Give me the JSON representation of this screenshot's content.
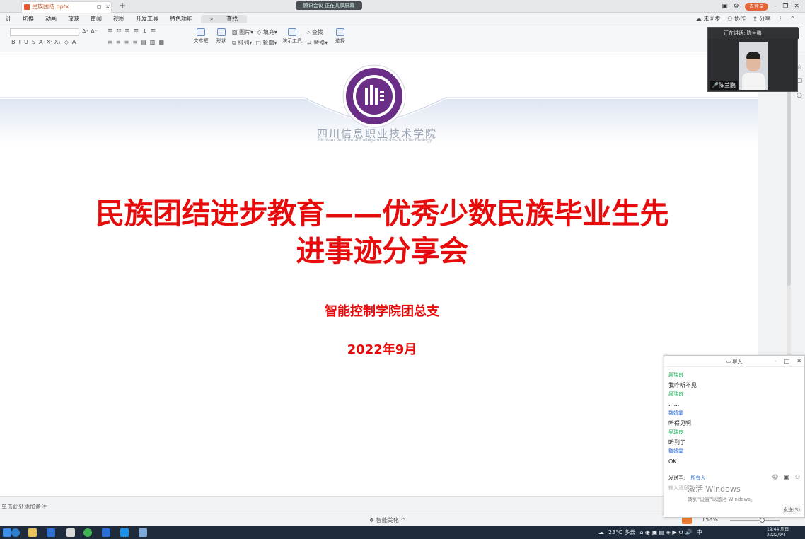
{
  "titlebar": {
    "tab_name": "民族团结.pptx",
    "new_tab": "+",
    "meeting_status": "腾讯会议 正在共享屏幕",
    "login_label": "去登录",
    "unsync": "未同步",
    "collab": "协作",
    "share": "分享"
  },
  "menu": {
    "items": [
      "计",
      "切换",
      "动画",
      "放映",
      "审阅",
      "视图",
      "开发工具",
      "特色功能"
    ],
    "search": "查找"
  },
  "ribbon": {
    "textbox": "文本框",
    "shape": "形状",
    "image": "图片",
    "arrange": "排列",
    "fill": "填充",
    "outline": "轮廓",
    "slide_tools": "演示工具",
    "find": "查找",
    "replace": "替换",
    "select": "选择"
  },
  "video": {
    "speaking": "正在讲话: 陈兰鹏",
    "name": "陈兰鹏"
  },
  "slide": {
    "college_cn": "四川信息职业技术学院",
    "college_en": "Sichuan Vocational College of Information Technology",
    "title": "民族团结进步教育——优秀少数民族毕业生先进事迹分享会",
    "subtitle": "智能控制学院团总支",
    "date": "2022年9月"
  },
  "notes": {
    "placeholder": "单击此处添加备注"
  },
  "status": {
    "beautify": "智能美化",
    "zoom": "158%"
  },
  "chat": {
    "title": "聊天",
    "messages": [
      {
        "sender": "吴瑞良",
        "text": "我咋听不见"
      },
      {
        "sender": "吴瑞良",
        "text": "......"
      },
      {
        "sender": "魏婧霎",
        "text": "听得见啊"
      },
      {
        "sender": "吴瑞良",
        "text": "听到了"
      },
      {
        "sender": "魏婧霎",
        "text": "OK"
      }
    ],
    "send_to_label": "发送至:",
    "send_to_value": "所有人",
    "input_placeholder": "输入消息...",
    "send_button": "发送(S)"
  },
  "watermark": {
    "line1": "激活 Windows",
    "line2": "转到\"设置\"以激活 Windows。"
  },
  "taskbar": {
    "weather": "23°C 多云",
    "ime": "中",
    "time": "19:44 周日",
    "date": "2022/9/4"
  }
}
